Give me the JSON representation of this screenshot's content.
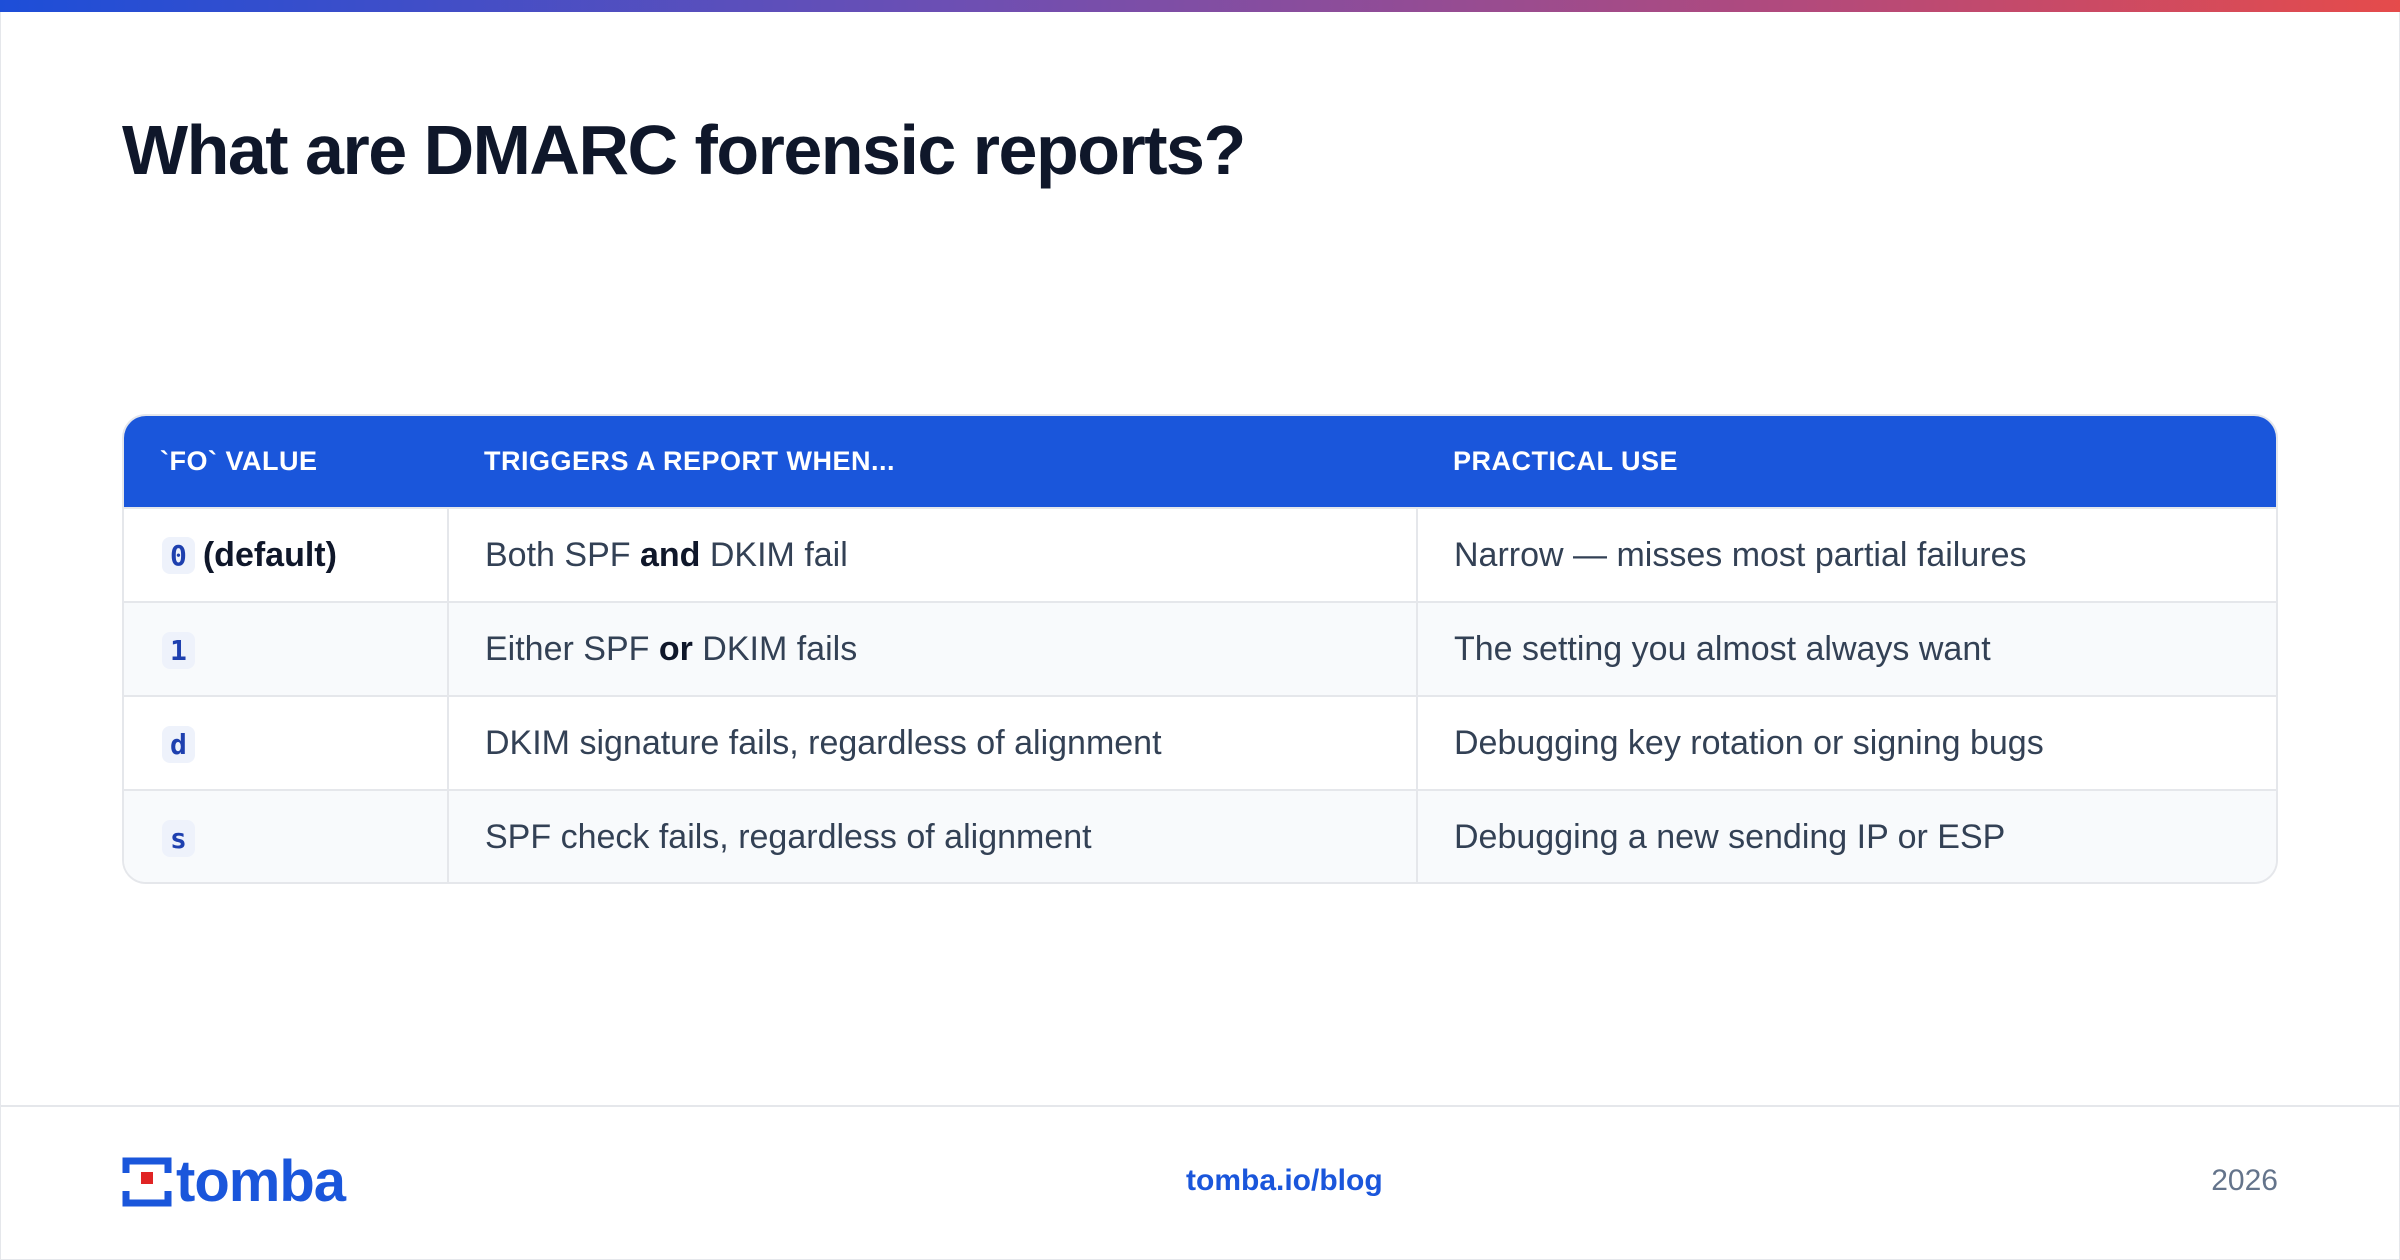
{
  "title": "What are DMARC forensic reports?",
  "table": {
    "headers": [
      "`FO` VALUE",
      "TRIGGERS A REPORT WHEN...",
      "PRACTICAL USE"
    ],
    "rows": [
      {
        "code": "0",
        "code_suffix": "(default)",
        "trigger_pre": "Both SPF ",
        "trigger_kw": "and",
        "trigger_post": " DKIM fail",
        "use": "Narrow — misses most partial failures"
      },
      {
        "code": "1",
        "code_suffix": "",
        "trigger_pre": "Either SPF ",
        "trigger_kw": "or",
        "trigger_post": " DKIM fails",
        "use": "The setting you almost always want"
      },
      {
        "code": "d",
        "code_suffix": "",
        "trigger_pre": "DKIM signature fails, regardless of alignment",
        "trigger_kw": "",
        "trigger_post": "",
        "use": "Debugging key rotation or signing bugs"
      },
      {
        "code": "s",
        "code_suffix": "",
        "trigger_pre": "SPF check fails, regardless of alignment",
        "trigger_kw": "",
        "trigger_post": "",
        "use": "Debugging a new sending IP or ESP"
      }
    ]
  },
  "footer": {
    "logo_text": "tomba",
    "link": "tomba.io/blog",
    "year": "2026"
  },
  "colors": {
    "brand_blue": "#1a56db",
    "logo_red": "#e02424",
    "title": "#0f172a",
    "code_text": "#1e40af"
  }
}
